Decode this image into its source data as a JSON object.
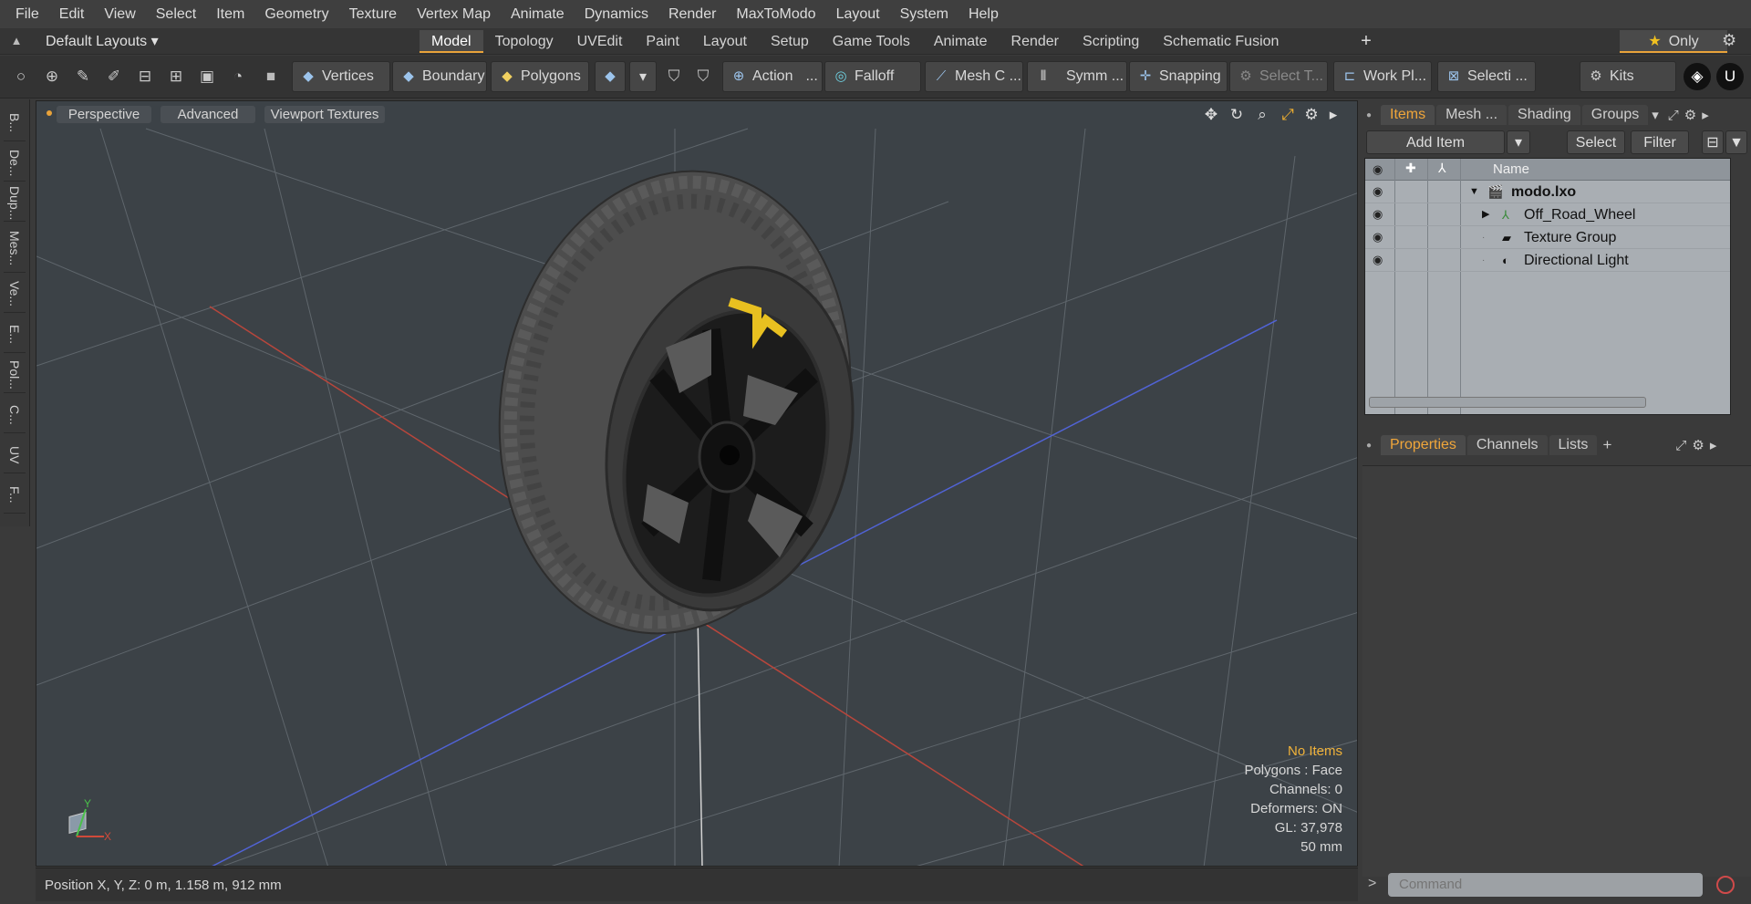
{
  "menubar": [
    "File",
    "Edit",
    "View",
    "Select",
    "Item",
    "Geometry",
    "Texture",
    "Vertex Map",
    "Animate",
    "Dynamics",
    "Render",
    "MaxToModo",
    "Layout",
    "System",
    "Help"
  ],
  "layout": {
    "dropdown": "Default Layouts ▾",
    "tabs": [
      "Model",
      "Topology",
      "UVEdit",
      "Paint",
      "Layout",
      "Setup",
      "Game Tools",
      "Animate",
      "Render",
      "Scripting",
      "Schematic Fusion"
    ],
    "active_tab": "Model",
    "add": "+",
    "only": "Only"
  },
  "toolbar": {
    "vertices": "Vertices",
    "boundary": "Boundary",
    "polygons": "Polygons",
    "action": "Action",
    "action_more": "...",
    "falloff": "Falloff",
    "mesh": "Mesh C ...",
    "symm": "Symm ...",
    "snapping": "Snapping",
    "select_t": "Select T...",
    "work_plane": "Work Pl...",
    "selection": "Selecti ...",
    "kits": "Kits"
  },
  "left_strip": [
    "B...",
    "De...",
    "Dup...",
    "Mes...",
    "Ve...",
    "E...",
    "Pol...",
    "C...",
    "UV",
    "F..."
  ],
  "viewport": {
    "perspective": "Perspective",
    "advanced": "Advanced",
    "viewport_textures": "Viewport Textures",
    "info": {
      "no_items": "No Items",
      "polygons": "Polygons : Face",
      "channels": "Channels: 0",
      "deformers": "Deformers: ON",
      "gl": "GL: 37,978",
      "scale": "50 mm"
    },
    "axis_y": "Y",
    "axis_x": "X"
  },
  "status": "Position X, Y, Z:   0 m, 1.158 m, 912 mm",
  "items_panel": {
    "tabs": [
      "Items",
      "Mesh ...",
      "Shading",
      "Groups"
    ],
    "active": "Items",
    "add_item": "Add Item",
    "select": "Select",
    "filter": "Filter",
    "name_col": "Name",
    "rows": [
      {
        "label": "modo.lxo",
        "indent": 0,
        "bold": true,
        "expander": "▼"
      },
      {
        "label": "Off_Road_Wheel",
        "indent": 1,
        "bold": false,
        "expander": "▶"
      },
      {
        "label": "Texture Group",
        "indent": 1,
        "bold": false,
        "expander": ""
      },
      {
        "label": "Directional Light",
        "indent": 1,
        "bold": false,
        "expander": ""
      }
    ]
  },
  "props_panel": {
    "tabs": [
      "Properties",
      "Channels",
      "Lists"
    ],
    "active": "Properties",
    "add": "+"
  },
  "command": {
    "placeholder": "Command",
    "arrow": ">"
  },
  "colors": {
    "accent": "#e8a23a",
    "viewport_bg": "#3c4247",
    "axis_x": "#c0443a",
    "axis_z": "#4a5ed8"
  }
}
